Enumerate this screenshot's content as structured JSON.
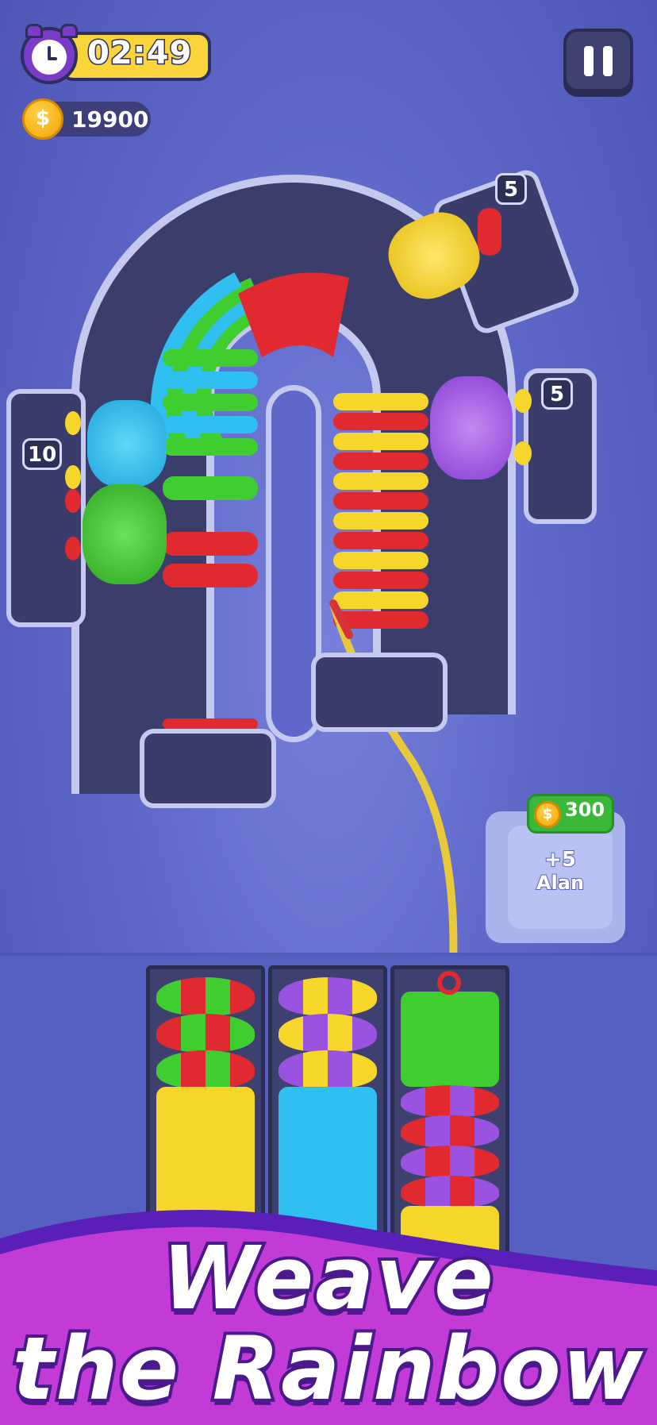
{
  "hud": {
    "timer": "02:49",
    "coins": "19900",
    "clock_icon": "alarm-clock-icon",
    "coin_icon": "coin-icon",
    "pause_icon": "pause-icon"
  },
  "machines": {
    "left_count": "10",
    "top_right_count": "5",
    "right_count": "5"
  },
  "bonus": {
    "price": "300",
    "reward": "+5",
    "name": "Alan"
  },
  "banner": {
    "line1": "Weave",
    "line2": "the Rainbow"
  },
  "colors": {
    "red": "#e02a2f",
    "green": "#3fcd2f",
    "blue": "#2fbff0",
    "yellow": "#f6d62a",
    "purple": "#9a52e0",
    "banner_magenta": "#c33bd6"
  }
}
